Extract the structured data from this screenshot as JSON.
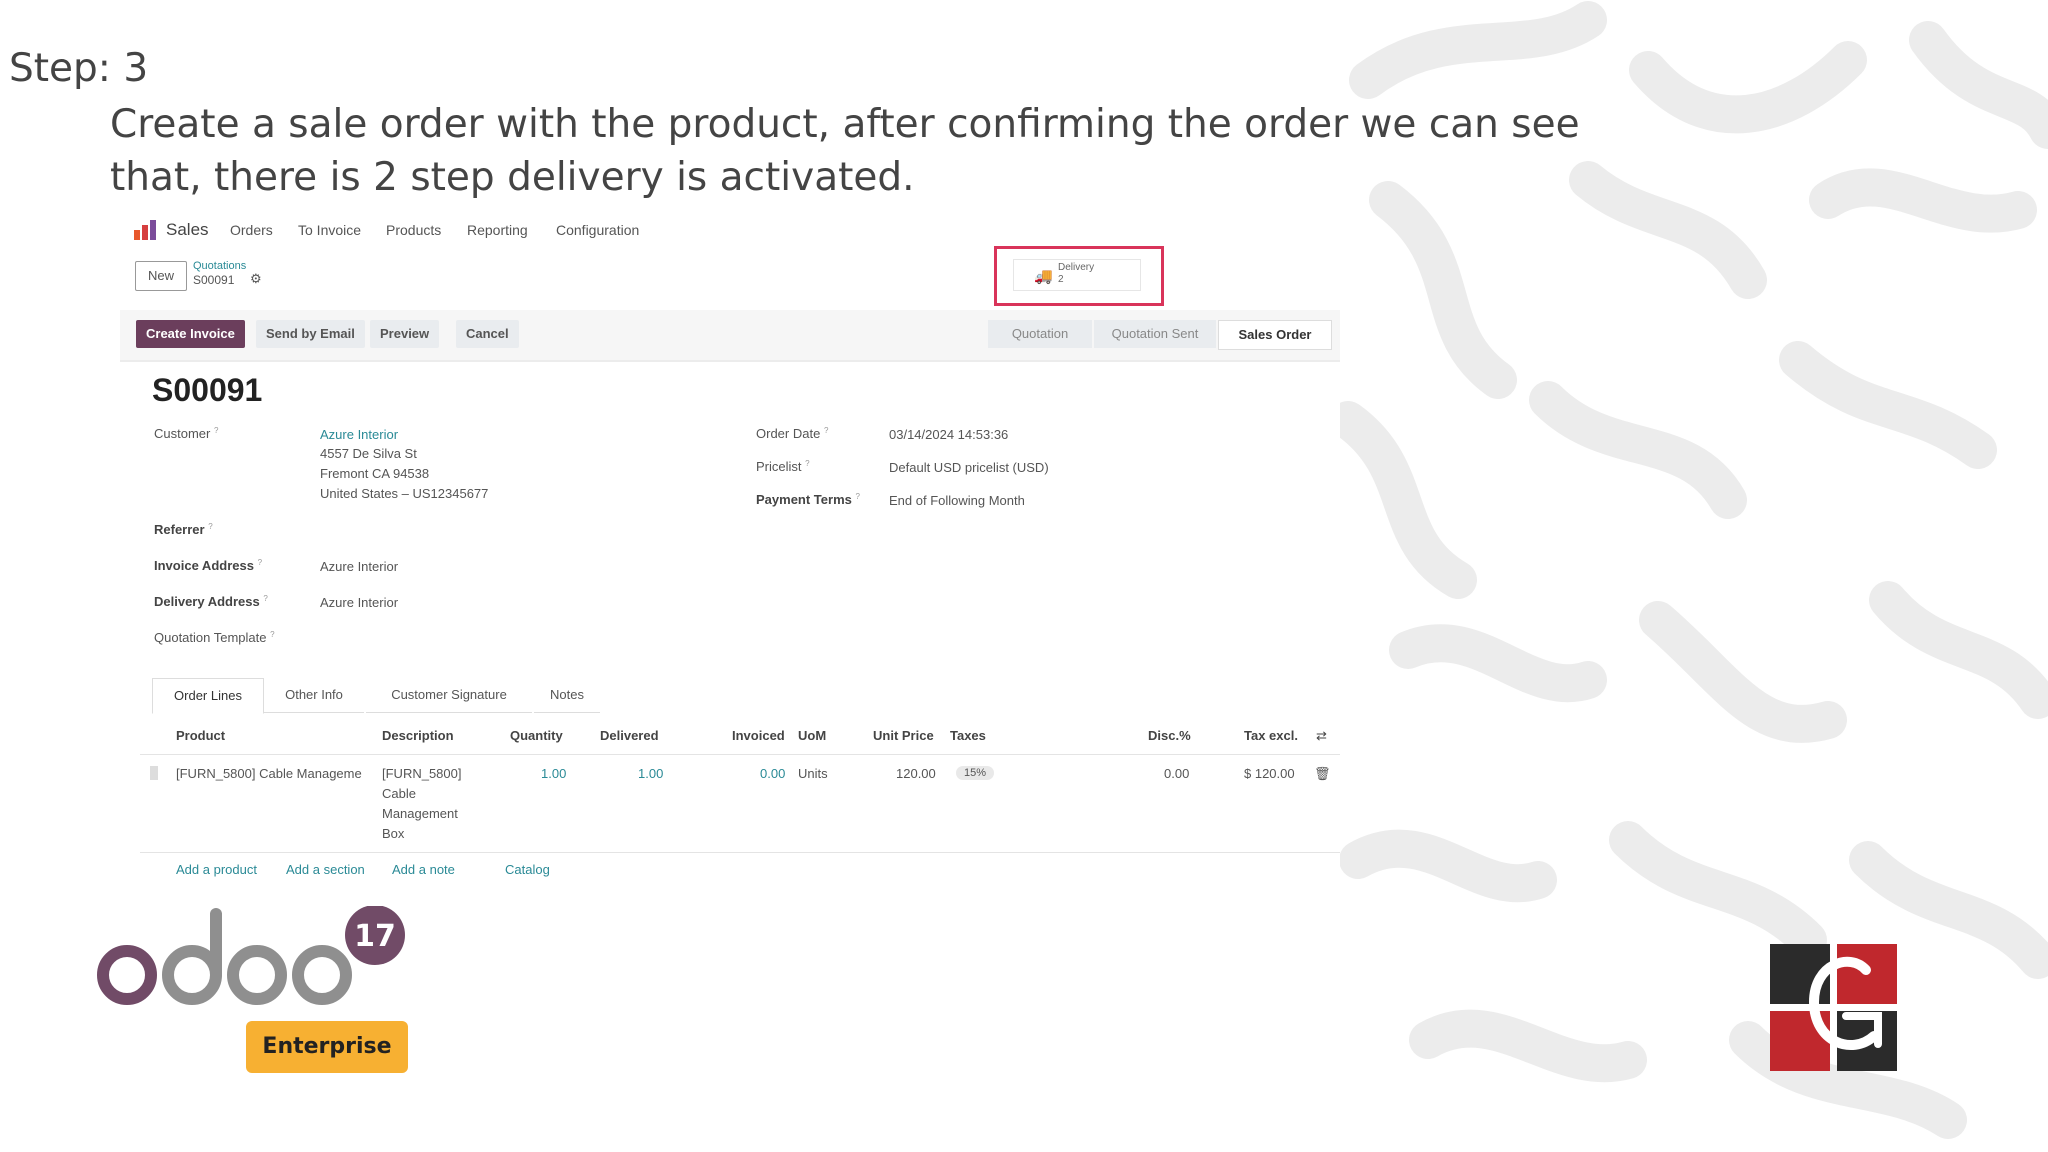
{
  "slide": {
    "step": "Step: 3",
    "body": "Create a sale order with the product, after confirming the order we can see that, there is 2 step delivery is activated."
  },
  "nav": {
    "app": "Sales",
    "items": [
      "Orders",
      "To Invoice",
      "Products",
      "Reporting",
      "Configuration"
    ]
  },
  "breadcrumb": {
    "new_label": "New",
    "parent": "Quotations",
    "current": "S00091"
  },
  "smart_button": {
    "label": "Delivery",
    "count": "2",
    "icon": "truck-icon"
  },
  "actions": {
    "create_invoice": "Create Invoice",
    "send_email": "Send by Email",
    "preview": "Preview",
    "cancel": "Cancel"
  },
  "statusbar": [
    "Quotation",
    "Quotation Sent",
    "Sales Order"
  ],
  "order": {
    "ref": "S00091",
    "customer_label": "Customer",
    "customer_name": "Azure Interior",
    "customer_addr1": "4557 De Silva St",
    "customer_addr2": "Fremont CA 94538",
    "customer_addr3": "United States – US12345677",
    "referrer_label": "Referrer",
    "invoice_addr_label": "Invoice Address",
    "invoice_addr": "Azure Interior",
    "delivery_addr_label": "Delivery Address",
    "delivery_addr": "Azure Interior",
    "template_label": "Quotation Template",
    "order_date_label": "Order Date",
    "order_date": "03/14/2024 14:53:36",
    "pricelist_label": "Pricelist",
    "pricelist": "Default USD pricelist (USD)",
    "payment_terms_label": "Payment Terms",
    "payment_terms": "End of Following Month"
  },
  "tabs": [
    "Order Lines",
    "Other Info",
    "Customer Signature",
    "Notes"
  ],
  "table": {
    "headers": {
      "product": "Product",
      "description": "Description",
      "quantity": "Quantity",
      "delivered": "Delivered",
      "invoiced": "Invoiced",
      "uom": "UoM",
      "unit_price": "Unit Price",
      "taxes": "Taxes",
      "disc": "Disc.%",
      "tax_excl": "Tax excl."
    },
    "row": {
      "product": "[FURN_5800] Cable Manageme",
      "desc1": "[FURN_5800]",
      "desc2": "Cable",
      "desc3": "Management",
      "desc4": "Box",
      "quantity": "1.00",
      "delivered": "1.00",
      "invoiced": "0.00",
      "uom": "Units",
      "unit_price": "120.00",
      "tax": "15%",
      "disc": "0.00",
      "subtotal": "$ 120.00"
    },
    "footer": [
      "Add a product",
      "Add a section",
      "Add a note",
      "Catalog"
    ]
  },
  "branding": {
    "odoo_version": "17",
    "edition": "Enterprise",
    "odoo_purple": "#714b67",
    "odoo_grey": "#8f8f8f",
    "enterprise_color": "#f7b032",
    "accent_red": "#d9345a"
  }
}
